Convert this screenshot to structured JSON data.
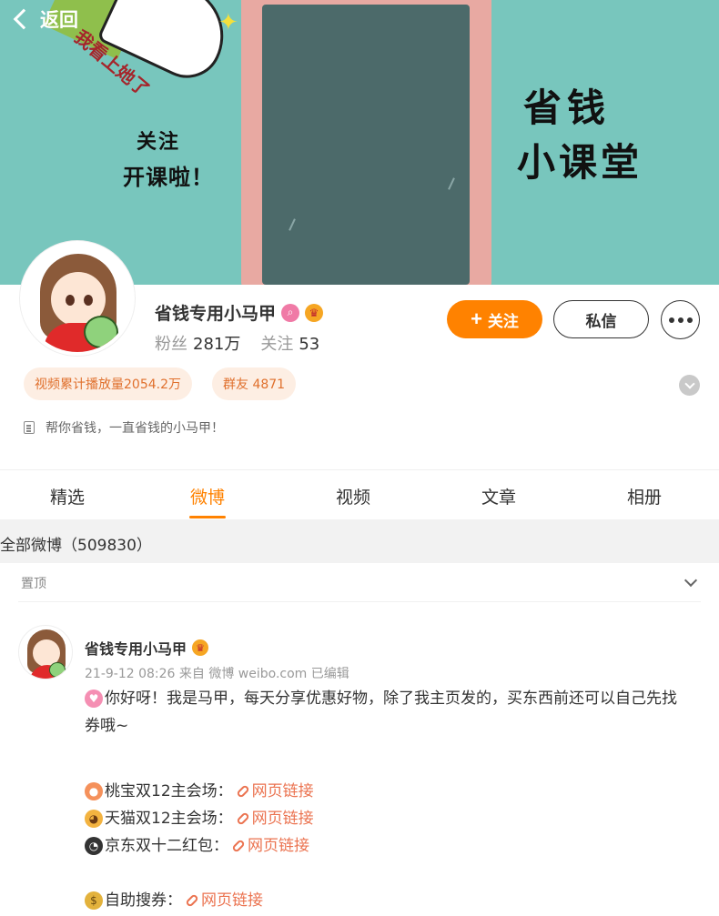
{
  "nav": {
    "back_label": "返回"
  },
  "banner": {
    "text_right_1": "省钱",
    "text_right_2": "小课堂",
    "text_left_1": "关注",
    "text_left_2": "开课啦！",
    "text_diag": "我看上她了",
    "sparkle": "✦"
  },
  "profile": {
    "name": "省钱专用小马甲",
    "fans_label": "粉丝",
    "fans_value": "281万",
    "follow_label": "关注",
    "follow_value": "53",
    "follow_button": "关注",
    "follow_plus": "+",
    "message_button": "私信",
    "tag_views": "视频累计播放量2054.2万",
    "tag_group": "群友 4871",
    "bio": "帮你省钱，一直省钱的小马甲！"
  },
  "tabs": [
    {
      "label": "精选"
    },
    {
      "label": "微博"
    },
    {
      "label": "视频"
    },
    {
      "label": "文章"
    },
    {
      "label": "相册"
    }
  ],
  "feed": {
    "all_label": "全部微博（509830）",
    "pinned_label": "置顶"
  },
  "post": {
    "author": "省钱专用小马甲",
    "meta": "21-9-12 08:26  来自 微博 weibo.com 已编辑",
    "line1": "你好呀！我是马甲，每天分享优惠好物，除了我主页发的，买东西前还可以自己先找",
    "line2": "券哦~",
    "item1": "桃宝双12主会场：",
    "item2": "天猫双12主会场：",
    "item3": "京东双十二红包：",
    "item4": "自助搜券：",
    "link_text": "网页链接"
  },
  "colors": {
    "accent": "#ff8200",
    "link": "#eb7350",
    "tag_bg": "#fdeee3",
    "banner_bg": "#78c6bd"
  }
}
